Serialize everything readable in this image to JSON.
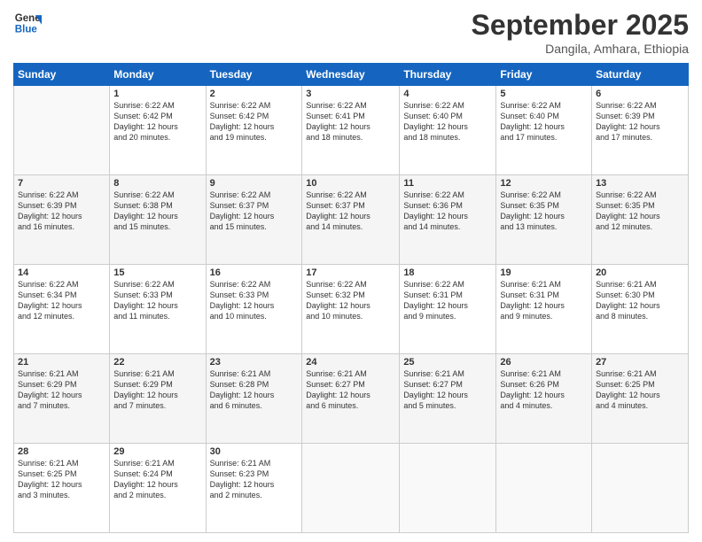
{
  "logo": {
    "line1": "General",
    "line2": "Blue"
  },
  "title": "September 2025",
  "location": "Dangila, Amhara, Ethiopia",
  "days_of_week": [
    "Sunday",
    "Monday",
    "Tuesday",
    "Wednesday",
    "Thursday",
    "Friday",
    "Saturday"
  ],
  "weeks": [
    [
      {
        "day": "",
        "info": ""
      },
      {
        "day": "1",
        "info": "Sunrise: 6:22 AM\nSunset: 6:42 PM\nDaylight: 12 hours\nand 20 minutes."
      },
      {
        "day": "2",
        "info": "Sunrise: 6:22 AM\nSunset: 6:42 PM\nDaylight: 12 hours\nand 19 minutes."
      },
      {
        "day": "3",
        "info": "Sunrise: 6:22 AM\nSunset: 6:41 PM\nDaylight: 12 hours\nand 18 minutes."
      },
      {
        "day": "4",
        "info": "Sunrise: 6:22 AM\nSunset: 6:40 PM\nDaylight: 12 hours\nand 18 minutes."
      },
      {
        "day": "5",
        "info": "Sunrise: 6:22 AM\nSunset: 6:40 PM\nDaylight: 12 hours\nand 17 minutes."
      },
      {
        "day": "6",
        "info": "Sunrise: 6:22 AM\nSunset: 6:39 PM\nDaylight: 12 hours\nand 17 minutes."
      }
    ],
    [
      {
        "day": "7",
        "info": "Sunrise: 6:22 AM\nSunset: 6:39 PM\nDaylight: 12 hours\nand 16 minutes."
      },
      {
        "day": "8",
        "info": "Sunrise: 6:22 AM\nSunset: 6:38 PM\nDaylight: 12 hours\nand 15 minutes."
      },
      {
        "day": "9",
        "info": "Sunrise: 6:22 AM\nSunset: 6:37 PM\nDaylight: 12 hours\nand 15 minutes."
      },
      {
        "day": "10",
        "info": "Sunrise: 6:22 AM\nSunset: 6:37 PM\nDaylight: 12 hours\nand 14 minutes."
      },
      {
        "day": "11",
        "info": "Sunrise: 6:22 AM\nSunset: 6:36 PM\nDaylight: 12 hours\nand 14 minutes."
      },
      {
        "day": "12",
        "info": "Sunrise: 6:22 AM\nSunset: 6:35 PM\nDaylight: 12 hours\nand 13 minutes."
      },
      {
        "day": "13",
        "info": "Sunrise: 6:22 AM\nSunset: 6:35 PM\nDaylight: 12 hours\nand 12 minutes."
      }
    ],
    [
      {
        "day": "14",
        "info": "Sunrise: 6:22 AM\nSunset: 6:34 PM\nDaylight: 12 hours\nand 12 minutes."
      },
      {
        "day": "15",
        "info": "Sunrise: 6:22 AM\nSunset: 6:33 PM\nDaylight: 12 hours\nand 11 minutes."
      },
      {
        "day": "16",
        "info": "Sunrise: 6:22 AM\nSunset: 6:33 PM\nDaylight: 12 hours\nand 10 minutes."
      },
      {
        "day": "17",
        "info": "Sunrise: 6:22 AM\nSunset: 6:32 PM\nDaylight: 12 hours\nand 10 minutes."
      },
      {
        "day": "18",
        "info": "Sunrise: 6:22 AM\nSunset: 6:31 PM\nDaylight: 12 hours\nand 9 minutes."
      },
      {
        "day": "19",
        "info": "Sunrise: 6:21 AM\nSunset: 6:31 PM\nDaylight: 12 hours\nand 9 minutes."
      },
      {
        "day": "20",
        "info": "Sunrise: 6:21 AM\nSunset: 6:30 PM\nDaylight: 12 hours\nand 8 minutes."
      }
    ],
    [
      {
        "day": "21",
        "info": "Sunrise: 6:21 AM\nSunset: 6:29 PM\nDaylight: 12 hours\nand 7 minutes."
      },
      {
        "day": "22",
        "info": "Sunrise: 6:21 AM\nSunset: 6:29 PM\nDaylight: 12 hours\nand 7 minutes."
      },
      {
        "day": "23",
        "info": "Sunrise: 6:21 AM\nSunset: 6:28 PM\nDaylight: 12 hours\nand 6 minutes."
      },
      {
        "day": "24",
        "info": "Sunrise: 6:21 AM\nSunset: 6:27 PM\nDaylight: 12 hours\nand 6 minutes."
      },
      {
        "day": "25",
        "info": "Sunrise: 6:21 AM\nSunset: 6:27 PM\nDaylight: 12 hours\nand 5 minutes."
      },
      {
        "day": "26",
        "info": "Sunrise: 6:21 AM\nSunset: 6:26 PM\nDaylight: 12 hours\nand 4 minutes."
      },
      {
        "day": "27",
        "info": "Sunrise: 6:21 AM\nSunset: 6:25 PM\nDaylight: 12 hours\nand 4 minutes."
      }
    ],
    [
      {
        "day": "28",
        "info": "Sunrise: 6:21 AM\nSunset: 6:25 PM\nDaylight: 12 hours\nand 3 minutes."
      },
      {
        "day": "29",
        "info": "Sunrise: 6:21 AM\nSunset: 6:24 PM\nDaylight: 12 hours\nand 2 minutes."
      },
      {
        "day": "30",
        "info": "Sunrise: 6:21 AM\nSunset: 6:23 PM\nDaylight: 12 hours\nand 2 minutes."
      },
      {
        "day": "",
        "info": ""
      },
      {
        "day": "",
        "info": ""
      },
      {
        "day": "",
        "info": ""
      },
      {
        "day": "",
        "info": ""
      }
    ]
  ]
}
